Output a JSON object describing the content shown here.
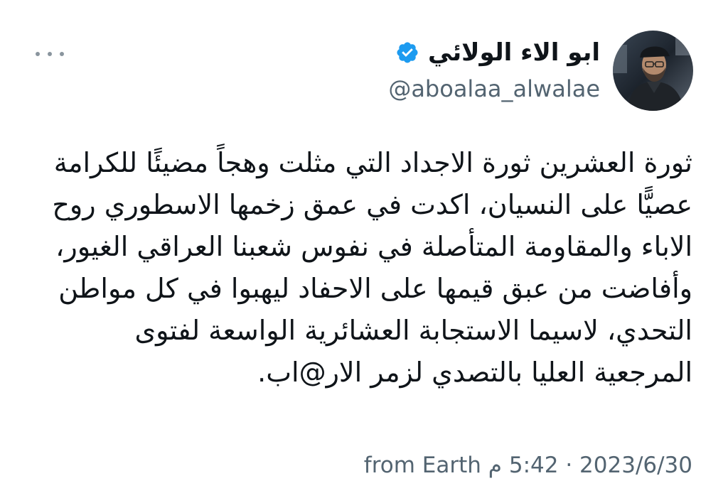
{
  "tweet": {
    "author": {
      "display_name": "ابو الاء الولائي",
      "handle": "@aboalaa_alwalae",
      "verified": true,
      "verified_color": "#1d9bf0"
    },
    "text_lines": [
      "ثورة العشرين ثورة الاجداد التي مثلت وهجاً مضيئًا للكرامة",
      "عصيًّا على النسيان، اكدت في عمق زخمها الاسطوري روح",
      "الاباء والمقاومة المتأصلة في نفوس شعبنا العراقي الغيور،",
      "وأفاضت من عبق قيمها على الاحفاد ليهبوا في كل مواطن",
      "التحدي، لاسيما الاستجابة العشائرية الواسعة لفتوى",
      "المرجعية العليا بالتصدي لزمر الار@اب."
    ],
    "meta": {
      "date": "2023/6/30",
      "separator": " · ",
      "time": "5:42 م",
      "source": "from Earth"
    },
    "icons": {
      "more": "more-horizontal-icon",
      "verified": "verified-badge-icon"
    }
  }
}
